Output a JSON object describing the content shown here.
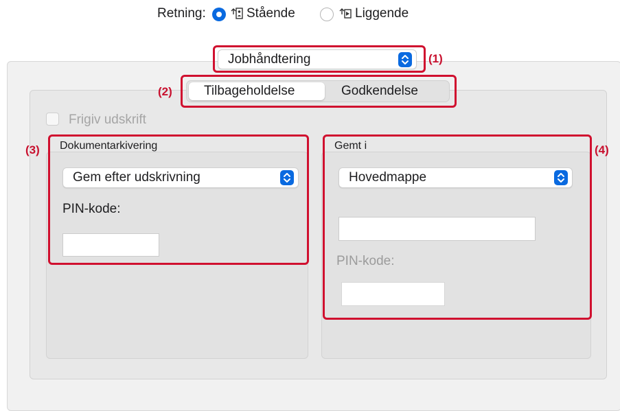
{
  "orientation": {
    "label": "Retning:",
    "options": [
      {
        "label": "Stående",
        "selected": true
      },
      {
        "label": "Liggende",
        "selected": false
      }
    ]
  },
  "job_popup": {
    "value": "Jobhåndtering"
  },
  "segments": {
    "items": [
      "Tilbageholdelse",
      "Godkendelse"
    ],
    "selected": "Tilbageholdelse"
  },
  "release_checkbox": {
    "label": "Frigiv udskrift",
    "checked": false,
    "enabled": false
  },
  "doc_filing": {
    "title": "Dokumentarkivering",
    "mode_value": "Gem efter udskrivning",
    "pin_label": "PIN-kode:",
    "pin_value": ""
  },
  "saved_in": {
    "title": "Gemt i",
    "folder_value": "Hovedmappe",
    "folder_name_value": "",
    "pin_label": "PIN-kode:",
    "pin_value": ""
  },
  "callouts": [
    "(1)",
    "(2)",
    "(3)",
    "(4)"
  ],
  "colors": {
    "accent": "#0a6ae0",
    "annotation": "#d0102f",
    "disabled_text": "#a5a5a5"
  }
}
